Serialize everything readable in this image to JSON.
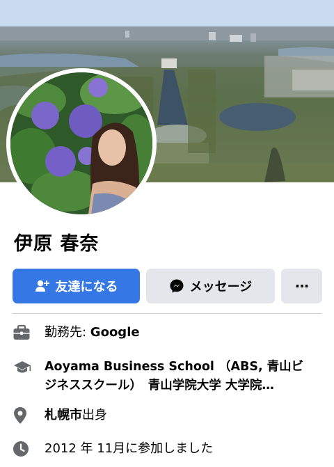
{
  "profile": {
    "name": "伊原 春奈"
  },
  "actions": {
    "add_friend_label": "友達になる",
    "message_label": "メッセージ",
    "more_label": "···"
  },
  "info": {
    "work_prefix": "勤務先: ",
    "work_value": "Google",
    "education_line1": "Aoyama Business School （ABS, 青山ビ",
    "education_line2": "ジネススクール）　青山学院大学 大学院…",
    "hometown_value": "札幌市",
    "hometown_suffix": "出身",
    "joined": "2012 年 11月に参加しました"
  },
  "icons": {
    "add_friend": "add-person-icon",
    "message": "messenger-icon",
    "more": "more-dots-icon",
    "work": "briefcase-icon",
    "education": "graduation-cap-icon",
    "hometown": "location-pin-icon",
    "joined": "clock-icon"
  },
  "colors": {
    "primary": "#3578e5",
    "secondary_button": "#e4e6eb",
    "icon_gray": "#65676b",
    "text": "#050505"
  }
}
